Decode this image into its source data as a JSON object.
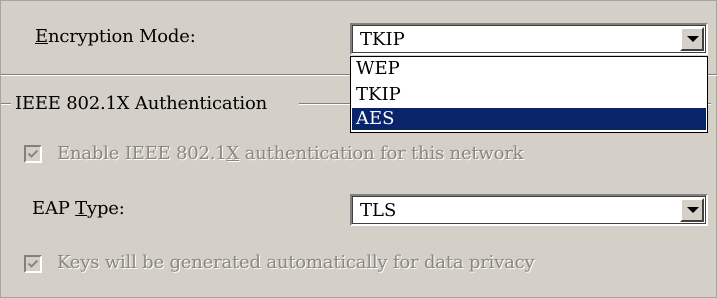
{
  "encryption": {
    "label_pre": "",
    "label_mnemonic": "E",
    "label_post": "ncryption Mode:",
    "selected": "TKIP",
    "options": [
      "WEP",
      "TKIP",
      "AES"
    ],
    "highlighted": "AES"
  },
  "group": {
    "title": "IEEE 802.1X Authentication"
  },
  "enable_8021x": {
    "label_pre": "Enable IEEE 802.1",
    "label_mnemonic": "X",
    "label_post": " authentication for this network",
    "checked": true,
    "enabled": false
  },
  "eap": {
    "label_pre": "EAP ",
    "label_mnemonic": "T",
    "label_post": "ype:",
    "selected": "TLS"
  },
  "auto_keys": {
    "label": "Keys will be generated automatically for data privacy",
    "checked": true,
    "enabled": false
  },
  "colors": {
    "background": "#d4d0c8",
    "highlight": "#0a246a",
    "disabled_text": "#8a877f"
  }
}
